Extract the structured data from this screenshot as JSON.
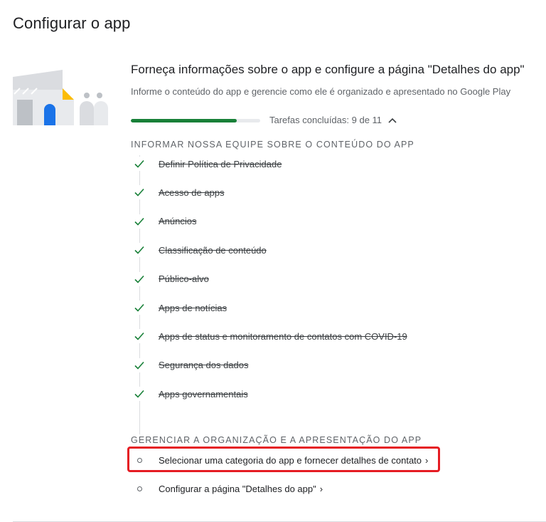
{
  "page": {
    "title": "Configurar o app"
  },
  "section": {
    "title": "Forneça informações sobre o app e configure a página \"Detalhes do app\"",
    "description": "Informe o conteúdo do app e gerencie como ele é organizado e apresentado no Google Play",
    "progress": {
      "completed": 9,
      "total": 11,
      "fraction": 0.818,
      "text": "Tarefas concluídas: 9 de 11"
    }
  },
  "groups": {
    "content": {
      "heading": "INFORMAR NOSSA EQUIPE SOBRE O CONTEÚDO DO APP",
      "tasks": [
        {
          "label": "Definir Política de Privacidade",
          "done": true
        },
        {
          "label": "Acesso de apps",
          "done": true
        },
        {
          "label": "Anúncios",
          "done": true
        },
        {
          "label": "Classificação de conteúdo",
          "done": true
        },
        {
          "label": "Público-alvo",
          "done": true
        },
        {
          "label": "Apps de notícias",
          "done": true
        },
        {
          "label": "Apps de status e monitoramento de contatos com COVID-19",
          "done": true
        },
        {
          "label": "Segurança dos dados",
          "done": true
        },
        {
          "label": "Apps governamentais",
          "done": true
        }
      ]
    },
    "presentation": {
      "heading": "GERENCIAR A ORGANIZAÇÃO E A APRESENTAÇÃO DO APP",
      "tasks": [
        {
          "label": "Selecionar uma categoria do app e fornecer detalhes de contato",
          "done": false,
          "chevron": "›"
        },
        {
          "label": "Configurar a página \"Detalhes do app\"",
          "done": false,
          "chevron": "›"
        }
      ]
    }
  },
  "colors": {
    "accent_green": "#188038",
    "highlight_red": "#e51c23",
    "illustration_blue": "#1a73e8",
    "illustration_yellow": "#fbbc04"
  },
  "icons": {
    "done": "checkmark-icon",
    "todo": "circle-icon",
    "collapse": "chevron-up-icon",
    "open": "chevron-right-icon"
  }
}
